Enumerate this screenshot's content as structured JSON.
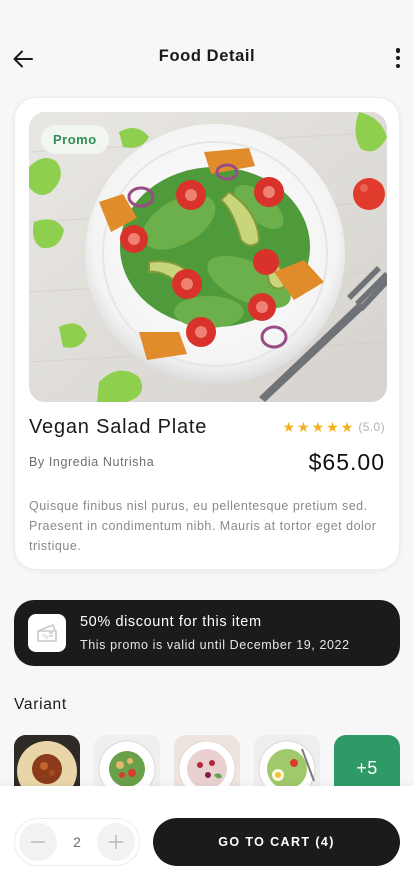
{
  "header": {
    "title": "Food Detail",
    "back_icon": "arrow-left-icon",
    "menu_icon": "more-vertical-icon"
  },
  "product": {
    "badge": "Promo",
    "name": "Vegan Salad Plate",
    "rating_stars": 5,
    "rating_text": "(5.0)",
    "author": "By Ingredia Nutrisha",
    "price": "$65.00",
    "description": "Quisque finibus nisl purus, eu pellentesque  pretium sed. Praesent in condimentum nibh. Mauris at tortor eget dolor tristique."
  },
  "discount": {
    "icon": "ticket-icon",
    "title": "50% discount for this item",
    "subtitle": "This promo is valid until December 19, 2022"
  },
  "variant": {
    "title": "Variant",
    "items": [
      "hummus-bowl",
      "chickpea-salad",
      "berry-yogurt-bowl",
      "egg-veggie-bowl"
    ],
    "more_label": "+5"
  },
  "cart": {
    "quantity": "2",
    "button_label": "GO TO CART (4)"
  },
  "colors": {
    "accent_green": "#2f9a68",
    "dark": "#1b1b1b",
    "star": "#f2b01e",
    "badge_bg": "#f1f7ee",
    "badge_text": "#2e8b57"
  }
}
